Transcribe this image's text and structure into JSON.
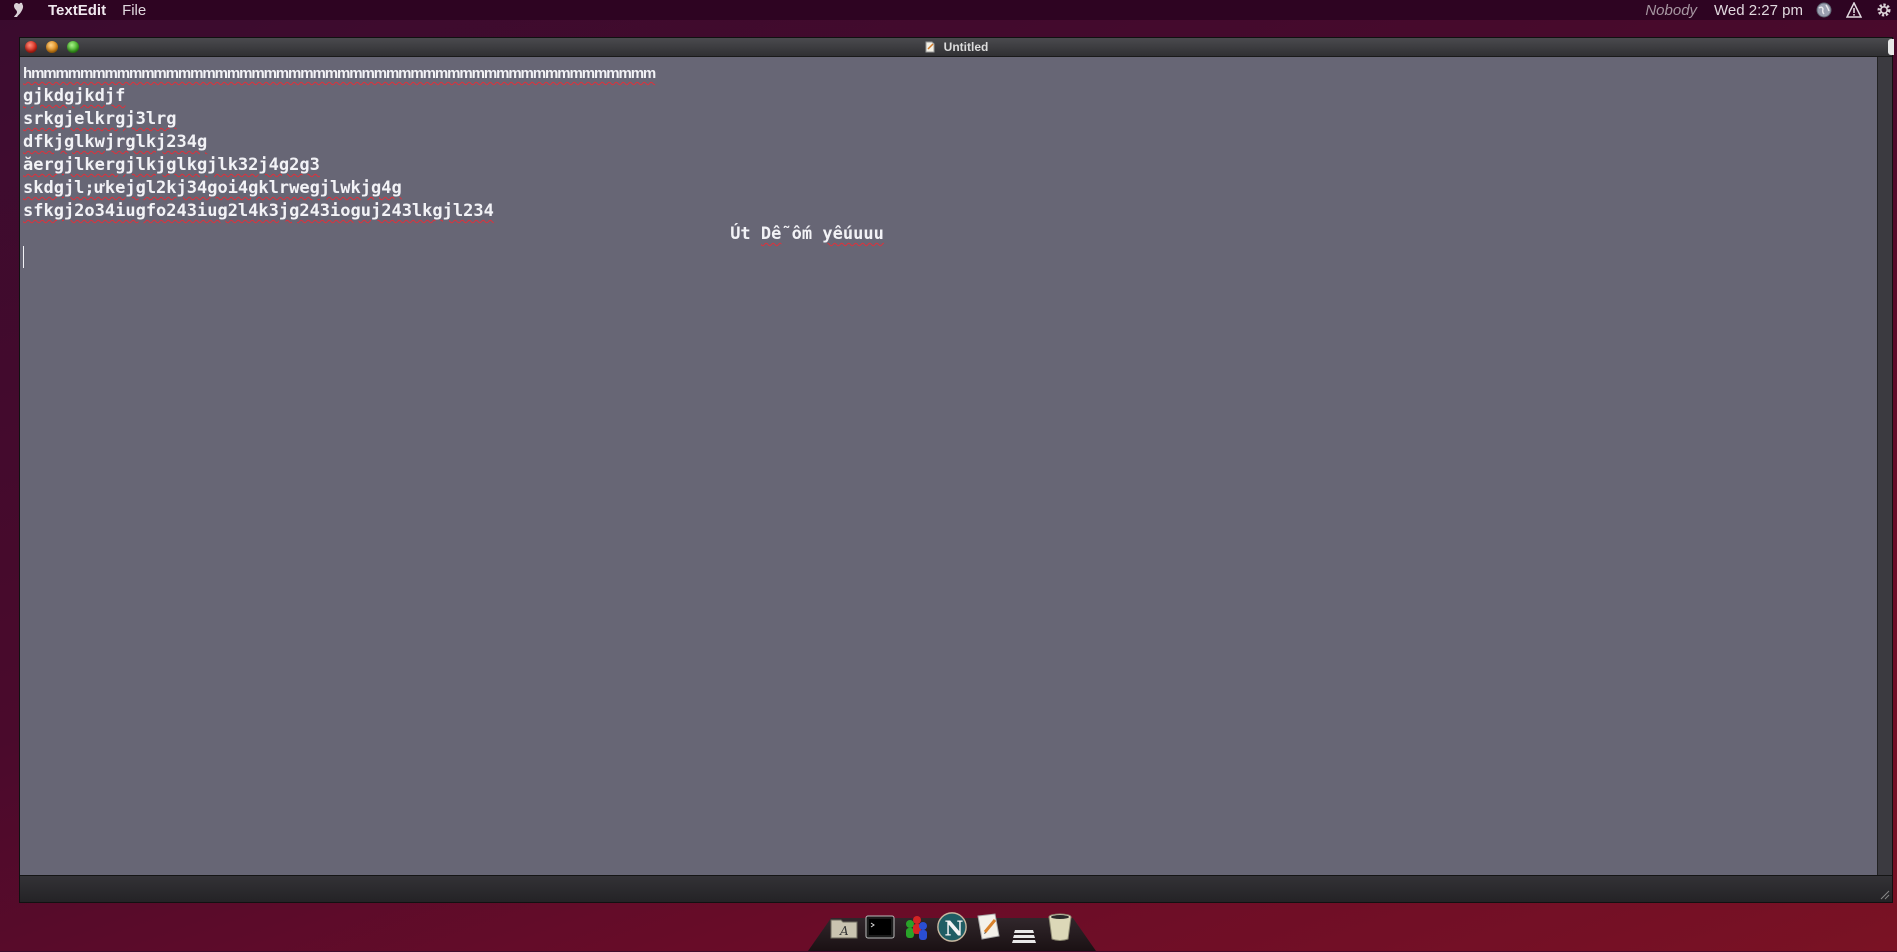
{
  "menubar": {
    "app_name": "TextEdit",
    "menus": [
      "File"
    ],
    "user": "Nobody",
    "clock": "Wed 2:27 pm",
    "tray_icons": [
      "globe-icon",
      "warning-icon",
      "gear-icon"
    ]
  },
  "window": {
    "title": "Untitled"
  },
  "document": {
    "lines": [
      "hmmmmmmmmmmmmmmmmmmmmmmmmmmmmmmmmmmmmmmmmmmmmmmmmmmm",
      "gjkdgjkdjf",
      "srkgjelkrgj3lrg",
      "dfkjglkwjrglkj234g",
      "ăergjlkergjlkjglkgjlk32j4g2g3",
      "skdgjl;ưkejgl2kj34goi4gklrwegjlwkjg4g",
      "sfkgj2o34iugfo243iug2l4k3jg243ioguj243lkgjl234"
    ],
    "centered_line": {
      "w1": "Út",
      "w2": "Dễ",
      "w3": "ốm",
      "w4": "yếuuuu"
    }
  },
  "dock": {
    "items": [
      "font-panel-icon",
      "terminal-icon",
      "users-icon",
      "browser-n-icon",
      "textedit-icon",
      "stack-icon",
      "trash-icon"
    ]
  },
  "colors": {
    "menubar_bg": "#2e0422",
    "content_bg": "#676675",
    "text": "#f2f2f6",
    "spellcheck": "#e0303a"
  }
}
